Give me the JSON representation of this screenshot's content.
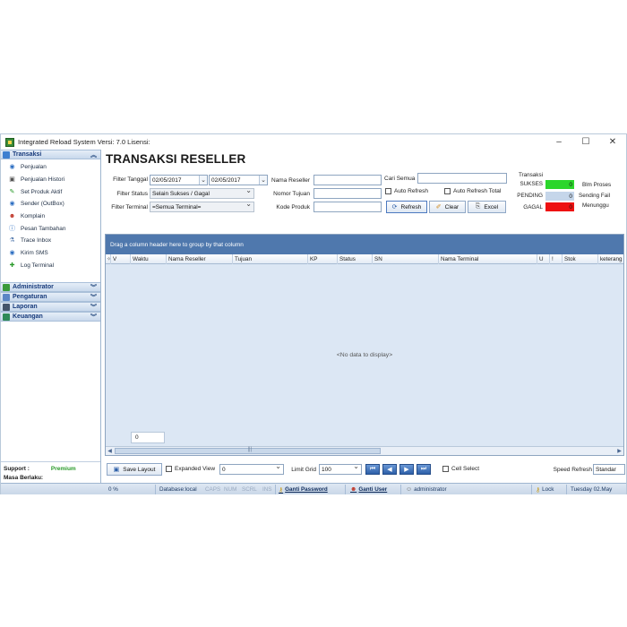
{
  "window": {
    "title": "Integrated Reload System Versi: 7.0 Lisensi:",
    "minimize": "–",
    "maximize": "☐",
    "close": "✕"
  },
  "sidebar": {
    "groups": [
      {
        "label": "Transaksi",
        "expanded": true,
        "items": [
          {
            "label": "Penjualan",
            "icon": "globe-icon"
          },
          {
            "label": "Penjualan Histori",
            "icon": "book-icon"
          },
          {
            "label": "Set Produk Aktif",
            "icon": "pin-icon"
          },
          {
            "label": "Sender (OutBox)",
            "icon": "globe-icon"
          },
          {
            "label": "Komplain",
            "icon": "person-icon"
          },
          {
            "label": "Pesan Tambahan",
            "icon": "info-icon"
          },
          {
            "label": "Trace Inbox",
            "icon": "flask-icon"
          },
          {
            "label": "Kirim SMS",
            "icon": "globe-icon"
          },
          {
            "label": "Log Terminal",
            "icon": "puzzle-icon"
          }
        ]
      },
      {
        "label": "Administrator",
        "expanded": false
      },
      {
        "label": "Pengaturan",
        "expanded": false
      },
      {
        "label": "Laporan",
        "expanded": false
      },
      {
        "label": "Keuangan",
        "expanded": false
      }
    ],
    "footer": {
      "support_label": "Support :",
      "support_value": "Premium",
      "expiry_label": "Masa Berlaku:"
    }
  },
  "main": {
    "title": "TRANSAKSI RESELLER",
    "filters": {
      "tanggal_label": "Filter Tanggal",
      "tanggal_from": "02/05/2017",
      "tanggal_to": "02/05/2017",
      "status_label": "Filter Status",
      "status_value": "Selain Sukses / Gagal",
      "terminal_label": "Filter Terminal",
      "terminal_value": "=Semua Terminal=",
      "reseller_label": "Nama Reseller",
      "reseller_value": "",
      "tujuan_label": "Nomor Tujuan",
      "tujuan_value": "",
      "produk_label": "Kode Produk",
      "produk_value": "",
      "cari_label": "Cari Semua",
      "cari_value": "",
      "auto_refresh_label": "Auto Refresh",
      "auto_refresh_total_label": "Auto Refresh Total"
    },
    "buttons": {
      "refresh": "Refresh",
      "clear": "Clear",
      "excel": "Excel"
    },
    "stats": {
      "heading": "Transaksi",
      "sukses_label": "SUKSES",
      "sukses_value": "0",
      "pending_label": "PENDING",
      "pending_value": "0",
      "gagal_label": "GAGAL",
      "gagal_value": "0",
      "blm_proses_label": "Blm Proses",
      "sending_fail_label": "Sending Fail",
      "menunggu_label": "Menunggu"
    },
    "grid": {
      "group_panel_text": "Drag a column header here to group by that column",
      "columns": [
        "V",
        "Waktu",
        "Nama Reseller",
        "Tujuan",
        "KP",
        "Status",
        "SN",
        "Nama Terminal",
        "U",
        "!",
        "Stok",
        "keterang"
      ],
      "empty_text": "<No data to display>",
      "footer_value": "0",
      "scroll_grip": "|||"
    },
    "bottombar": {
      "save_layout": "Save Layout",
      "expanded_view_label": "Expanded View",
      "expanded_view_value": "0",
      "limit_grid_label": "Limit Grid",
      "limit_grid_value": "100",
      "cell_select_label": "Cell Select",
      "speed_refresh_label": "Speed Refresh",
      "speed_refresh_value": "Standar"
    }
  },
  "statusbar": {
    "progress": "0 %",
    "database": "Database:local",
    "caps": "CAPS",
    "num": "NUM",
    "scrl": "SCRL",
    "ins": "INS",
    "ganti_password": "Ganti Password",
    "ganti_user": "Ganti User",
    "user": "administrator",
    "lock": "Lock",
    "date": "Tuesday 02.May"
  },
  "colors": {
    "sukses": "#2bd62b",
    "pending": "#c5d6ea",
    "gagal": "#ee1111",
    "group_panel": "#4f78ad"
  }
}
